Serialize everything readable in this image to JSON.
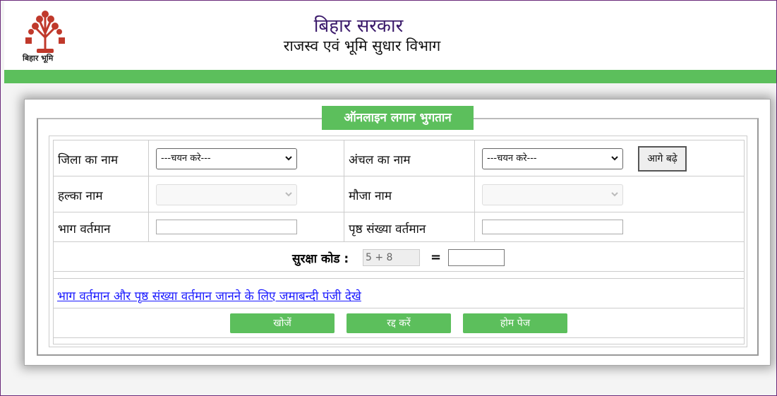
{
  "header": {
    "logo_caption": "बिहार भूमि",
    "title": "बिहार सरकार",
    "subtitle": "राजस्व एवं भूमि सुधार विभाग"
  },
  "form": {
    "legend": "ऑनलाइन लगान भुगतान",
    "district_label": "जिला का नाम",
    "district_value": "---चयन करे---",
    "circle_label": "अंचल का नाम",
    "circle_value": "---चयन करे---",
    "next_button": "आगे बढ़े",
    "halka_label": "हल्का नाम",
    "mauza_label": "मौजा नाम",
    "bhag_label": "भाग वर्तमान",
    "page_label": "पृष्ठ संख्या वर्तमान",
    "captcha_label": "सुरक्षा कोड :",
    "captcha_value": "5 + 8",
    "equals": "=",
    "jamabandi_link": "भाग वर्तमान और पृष्ठ संख्या वर्तमान जानने के लिए जमाबन्दी पंजी देखे",
    "search_button": "खोजें",
    "cancel_button": "रद्द करें",
    "home_button": "होम पेज"
  },
  "colors": {
    "accent_green": "#5cbf5c",
    "title_purple": "#3b1a6b",
    "link_blue": "#1a1aff"
  }
}
